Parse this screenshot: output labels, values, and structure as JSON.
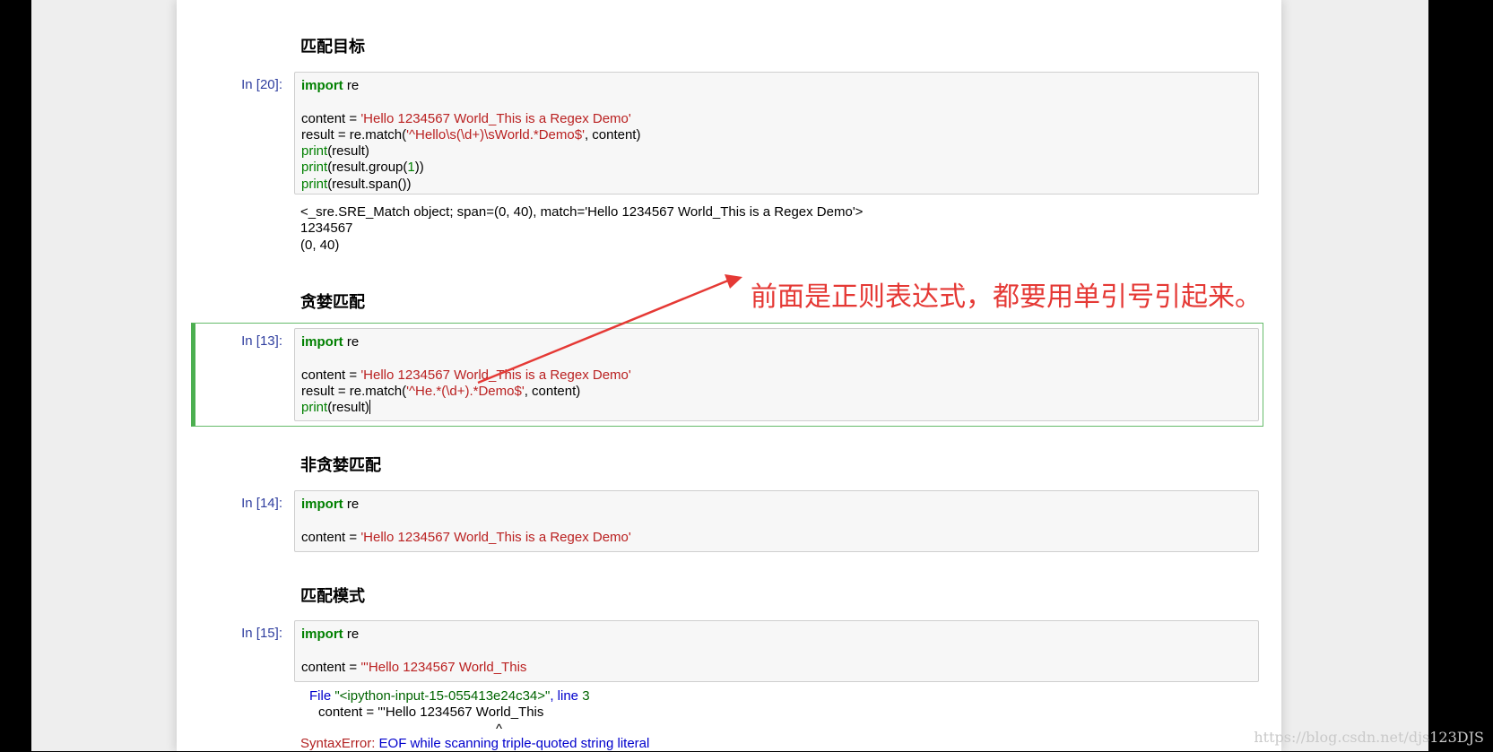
{
  "cells": {
    "match_target": {
      "heading": "匹配目标",
      "prompt": "In [20]:",
      "code": {
        "l1_kw": "import",
        "l1_rest": " re",
        "l3_a": "content = ",
        "l3_s": "'Hello 1234567 World_This is a Regex Demo'",
        "l4_a": "result = re.match(",
        "l4_s": "'^Hello\\s(\\d+)\\sWorld.*Demo$'",
        "l4_b": ", content)",
        "l5_f": "print",
        "l5_b": "(result)",
        "l6_f": "print",
        "l6_b": "(result.group(",
        "l6_n": "1",
        "l6_c": "))",
        "l7_f": "print",
        "l7_b": "(result.span())"
      },
      "output": [
        "<_sre.SRE_Match object; span=(0, 40), match='Hello 1234567 World_This is a Regex Demo'>",
        "1234567",
        "(0, 40)"
      ]
    },
    "greedy": {
      "heading": "贪婪匹配",
      "prompt": "In [13]:",
      "code": {
        "l1_kw": "import",
        "l1_rest": " re",
        "l3_a": "content = ",
        "l3_s": "'Hello 1234567 World_This is a Regex Demo'",
        "l4_a": "result = re.match(",
        "l4_s": "'^He.*(\\d+).*Demo$'",
        "l4_b": ", content)",
        "l5_f": "print",
        "l5_b": "(result)"
      }
    },
    "non_greedy": {
      "heading": "非贪婪匹配",
      "prompt": "In [14]:",
      "code": {
        "l1_kw": "import",
        "l1_rest": " re",
        "l3_a": "content = ",
        "l3_s": "'Hello 1234567 World_This is a Regex Demo'"
      }
    },
    "match_mode": {
      "heading": "匹配模式",
      "prompt": "In [15]:",
      "code": {
        "l1_kw": "import",
        "l1_rest": " re",
        "l3_a": "content = ",
        "l3_s": "'''Hello 1234567 World_This"
      },
      "traceback": {
        "file_label": "File ",
        "file_name": "\"<ipython-input-15-055413e24c34>\"",
        "line_label": ", line ",
        "line_num": "3",
        "code_line": "content = '''Hello 1234567 World_This",
        "caret": "^",
        "error_name": "SyntaxError:",
        "error_msg": " EOF while scanning triple-quoted string literal"
      }
    }
  },
  "annotation": {
    "text": "前面是正则表达式，都要用单引号引起来。",
    "color": "#e53935"
  },
  "watermark": "https://blog.csdn.net/djs123DJS"
}
